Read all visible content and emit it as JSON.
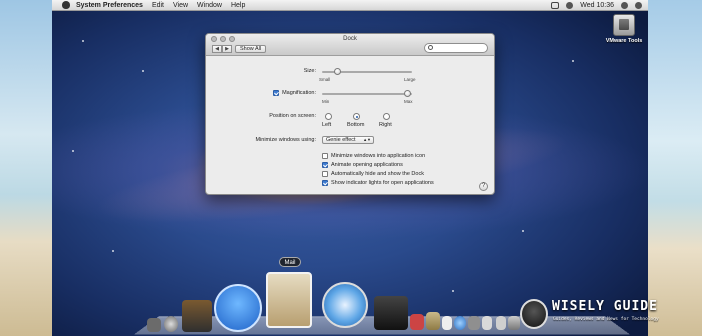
{
  "menubar": {
    "app_name": "System Preferences",
    "items": [
      "Edit",
      "View",
      "Window",
      "Help"
    ],
    "clock": "Wed 10:36"
  },
  "desktop": {
    "icon_label": "VMware Tools"
  },
  "window": {
    "title": "Dock",
    "show_all": "Show All",
    "search_placeholder": "",
    "size": {
      "label": "Size:",
      "min": "Small",
      "max": "Large",
      "level": 0.1
    },
    "magnification": {
      "label": "Magnification:",
      "checked": true,
      "min": "Min",
      "max": "Max",
      "level": 0.98
    },
    "position": {
      "label": "Position on screen:",
      "options": [
        "Left",
        "Bottom",
        "Right"
      ],
      "selected": "Bottom"
    },
    "minimize": {
      "label": "Minimize windows using:",
      "value": "Genie effect"
    },
    "checkboxes": [
      {
        "label": "Minimize windows into application icon",
        "checked": false
      },
      {
        "label": "Animate opening applications",
        "checked": true
      },
      {
        "label": "Automatically hide and show the Dock",
        "checked": false
      },
      {
        "label": "Show indicator lights for open applications",
        "checked": true
      }
    ],
    "help": "?"
  },
  "dock": {
    "tooltip": "Mail"
  },
  "watermark": {
    "brand": "WISELY GUIDE",
    "tagline": "Guides, Reviews and News for Technology"
  },
  "colors": {
    "accent": "#3d7bd1",
    "wallpaper": "#182e63"
  }
}
